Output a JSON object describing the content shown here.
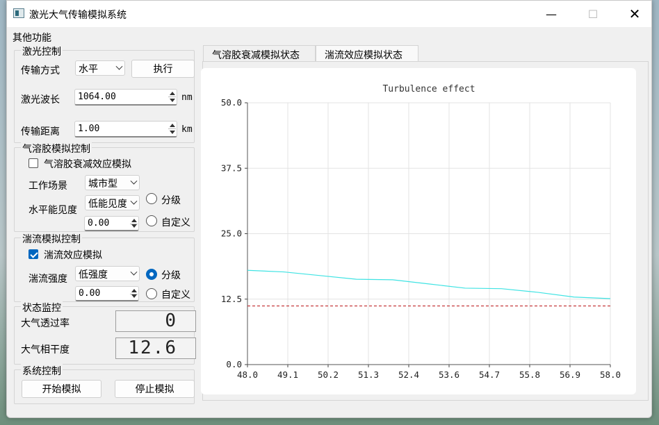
{
  "window": {
    "title": "激光大气传输模拟系统",
    "controls": {
      "minimize": "—",
      "maximize": "☐",
      "close": "✕"
    }
  },
  "menu": {
    "items": [
      "其他功能"
    ]
  },
  "laser_group": {
    "title": "激光控制",
    "transmission_label": "传输方式",
    "transmission_value": "水平",
    "execute_label": "执行",
    "wavelength_label": "激光波长",
    "wavelength_value": "1064.00",
    "wavelength_unit": "nm",
    "distance_label": "传输距离",
    "distance_value": "1.00",
    "distance_unit": "km"
  },
  "aerosol_group": {
    "title": "气溶胶模拟控制",
    "checkbox_label": "气溶胶衰减效应模拟",
    "checkbox_checked": false,
    "scene_label": "工作场景",
    "scene_value": "城市型",
    "visibility_label": "水平能见度",
    "visibility_value": "低能见度",
    "visibility_number": "0.00",
    "radio_graded": "分级",
    "radio_custom": "自定义"
  },
  "turbulence_group": {
    "title": "湍流模拟控制",
    "checkbox_label": "湍流效应模拟",
    "checkbox_checked": true,
    "strength_label": "湍流强度",
    "strength_value": "低强度",
    "strength_number": "0.00",
    "radio_graded": "分级",
    "radio_custom": "自定义"
  },
  "status_group": {
    "title": "状态监控",
    "transmittance_label": "大气透过率",
    "transmittance_value": "0",
    "coherence_label": "大气相干度",
    "coherence_value": "12.6"
  },
  "system_group": {
    "title": "系统控制",
    "start_label": "开始模拟",
    "stop_label": "停止模拟"
  },
  "tabs": [
    {
      "label": "气溶胶衰减模拟状态",
      "active": false
    },
    {
      "label": "湍流效应模拟状态",
      "active": true
    }
  ],
  "chart_data": {
    "type": "line",
    "title": "Turbulence effect",
    "xlabel": "",
    "ylabel": "",
    "xlim": [
      48.0,
      58.0
    ],
    "ylim": [
      0.0,
      50.0
    ],
    "x_ticks": [
      "48.0",
      "49.1",
      "50.2",
      "51.3",
      "52.4",
      "53.6",
      "54.7",
      "55.8",
      "56.9",
      "58.0"
    ],
    "y_ticks": [
      "0.0",
      "12.5",
      "25.0",
      "37.5",
      "50.0"
    ],
    "grid": true,
    "series": [
      {
        "color": "#3fe3e3",
        "style": "solid",
        "x": [
          48.0,
          49.0,
          50.0,
          51.0,
          52.0,
          53.0,
          54.0,
          55.0,
          56.0,
          57.0,
          58.0
        ],
        "y": [
          18.0,
          17.7,
          17.0,
          16.3,
          16.2,
          15.4,
          14.6,
          14.5,
          13.8,
          12.9,
          12.6
        ]
      },
      {
        "color": "#c0282a",
        "style": "dashed",
        "x": [
          48.0,
          58.0
        ],
        "y": [
          11.2,
          11.2
        ]
      }
    ]
  }
}
